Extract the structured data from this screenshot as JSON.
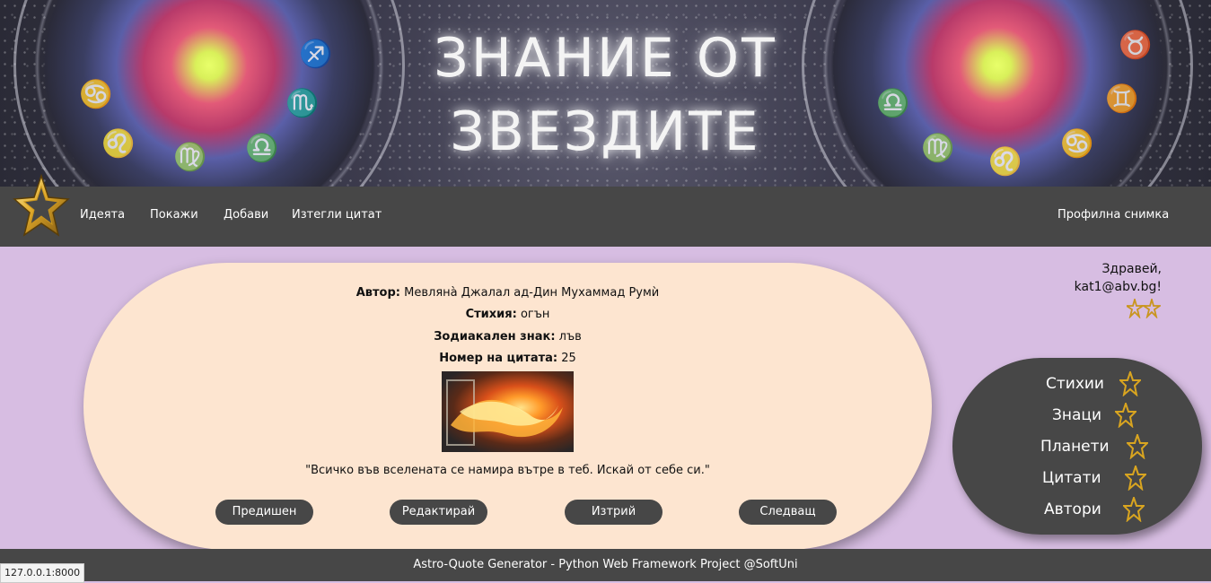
{
  "header": {
    "title_line1": "ЗНАНИЕ ОТ",
    "title_line2": "ЗВЕЗДИТЕ"
  },
  "nav": {
    "items": [
      {
        "label": "Идеята"
      },
      {
        "label": "Покажи"
      },
      {
        "label": "Добави"
      },
      {
        "label": "Изтегли цитат"
      }
    ],
    "profile_label": "Профилна снимка"
  },
  "greeting": {
    "line1": "Здравей,",
    "line2": "kat1@abv.bg!"
  },
  "side_menu": {
    "items": [
      {
        "label": "Стихии"
      },
      {
        "label": "Знаци"
      },
      {
        "label": "Планети"
      },
      {
        "label": "Цитати"
      },
      {
        "label": "Автори"
      }
    ]
  },
  "quote": {
    "author_label": "Автор",
    "author_value": "Мевляна̀ Джалал ад-Дин Мухаммад Румѝ",
    "element_label": "Стихия",
    "element_value": "огън",
    "sign_label": "Зодиакален знак",
    "sign_value": "лъв",
    "number_label": "Номер на цитата",
    "number_value": "25",
    "text": "\"Всичко във вселената се намира вътре в теб. Искай от себе си.\""
  },
  "buttons": {
    "prev": "Предишен",
    "edit": "Редактирай",
    "delete": "Изтрий",
    "next": "Следващ"
  },
  "footer": {
    "text": "Astro-Quote Generator - Python Web Framework Project @SoftUni"
  },
  "status_bar": {
    "url": "127.0.0.1:8000"
  },
  "colors": {
    "page_bg": "#d7bde2",
    "bar_bg": "#474747",
    "card_bg": "#fde5d0",
    "star_gold": "#d9a520"
  }
}
